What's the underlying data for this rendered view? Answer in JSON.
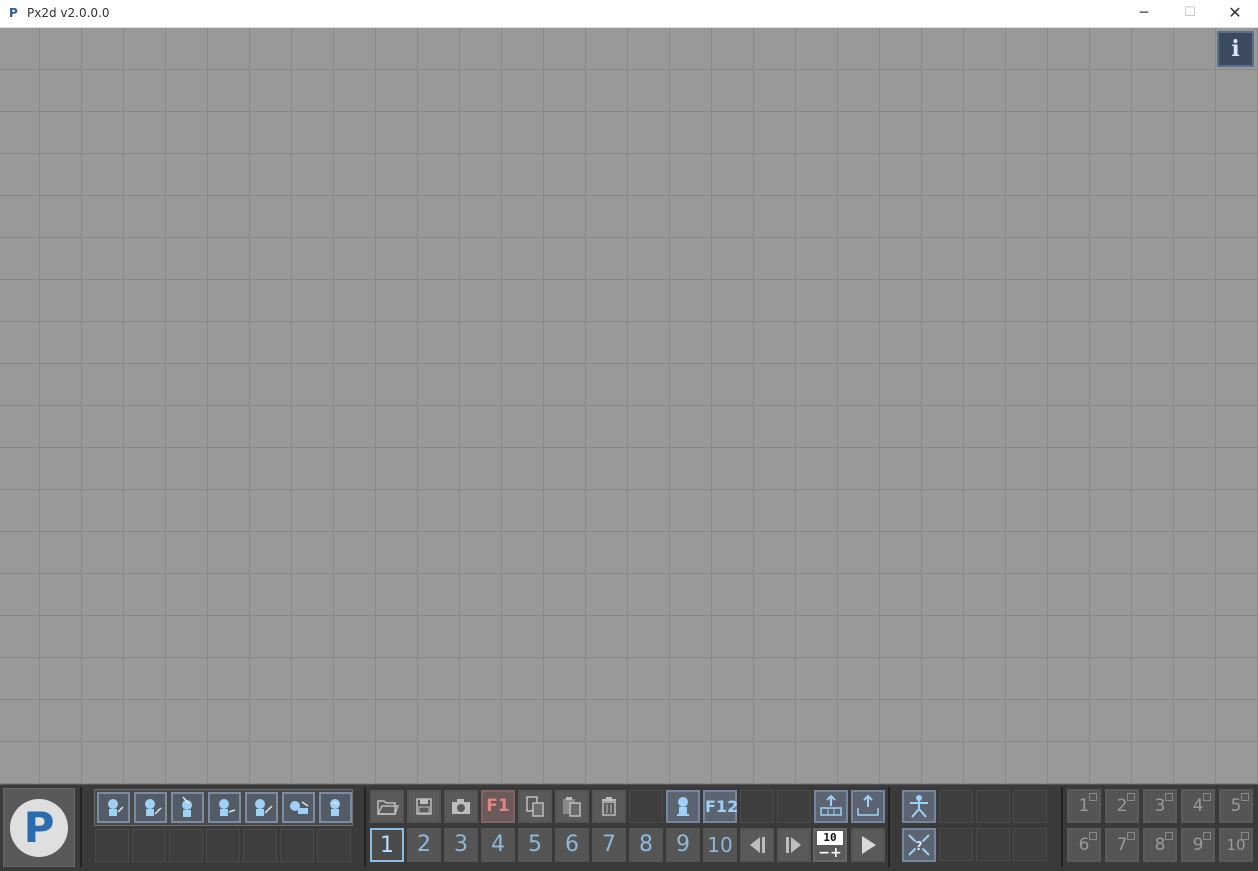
{
  "window": {
    "logo_letter": "P",
    "title": "Px2d  v2.0.0.0",
    "minimize_glyph": "─",
    "maximize_glyph": "☐",
    "close_glyph": "✕"
  },
  "canvas": {
    "info_label": "i"
  },
  "logo_panel": {
    "letter": "P"
  },
  "sprite_slots": [
    {
      "icon": "sprite-pose-1-icon"
    },
    {
      "icon": "sprite-pose-2-icon"
    },
    {
      "icon": "sprite-pose-3-icon"
    },
    {
      "icon": "sprite-pose-4-icon"
    },
    {
      "icon": "sprite-pose-5-icon"
    },
    {
      "icon": "sprite-pose-6-icon"
    },
    {
      "icon": "sprite-pose-7-icon"
    }
  ],
  "toolbar": {
    "f1_label": "F1",
    "f12_label": "F12"
  },
  "frames": [
    "1",
    "2",
    "3",
    "4",
    "5",
    "6",
    "7",
    "8",
    "9",
    "10"
  ],
  "playback": {
    "speed_value": "10",
    "speed_controls": "−+"
  },
  "layers_top": [
    "1",
    "2",
    "3",
    "4",
    "5"
  ],
  "layers_bottom": [
    "6",
    "7",
    "8",
    "9",
    "10"
  ],
  "colors": {
    "accent_blue": "#8fbde0",
    "f1_red": "#e38383",
    "logo_blue": "#2b6cb0"
  }
}
